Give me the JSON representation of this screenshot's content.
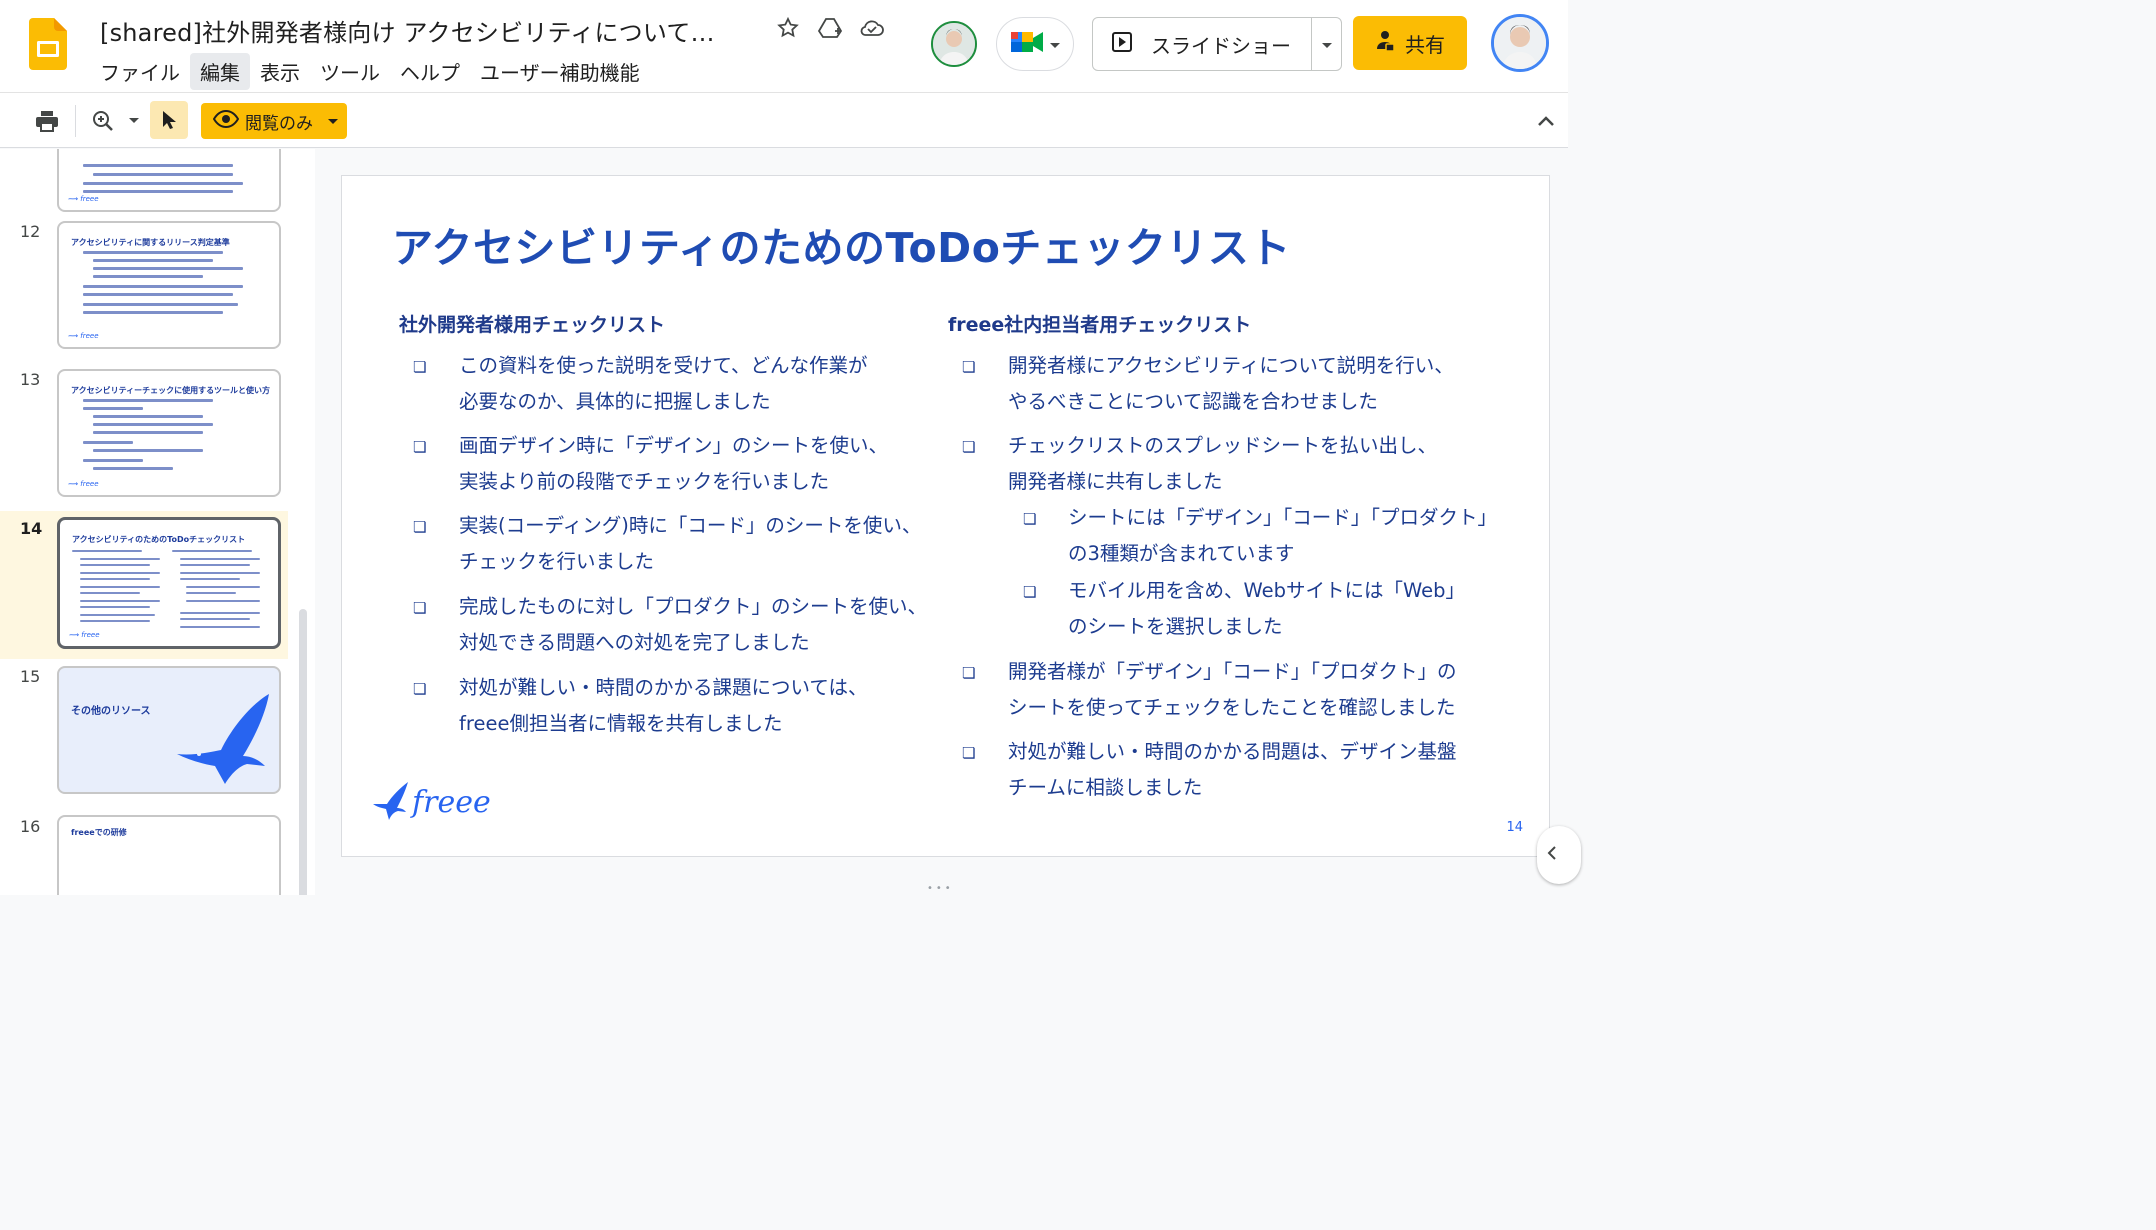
{
  "app": {
    "doc_title": "[shared]社外開発者様向け アクセシビリティについて…",
    "menu": [
      "ファイル",
      "編集",
      "表示",
      "ツール",
      "ヘルプ",
      "ユーザー補助機能"
    ],
    "slideshow_label": "スライドショー",
    "share_label": "共有"
  },
  "toolbar": {
    "view_only_label": "閲覧のみ"
  },
  "colors": {
    "accent": "#fbbc04",
    "slide_blue": "#1f4cb3",
    "brand": "#2864f0"
  },
  "thumbnails": [
    {
      "num": "",
      "title": ""
    },
    {
      "num": "12",
      "title": "アクセシビリティに関するリリース判定基準"
    },
    {
      "num": "13",
      "title": "アクセシビリティーチェックに使用するツールと使い方"
    },
    {
      "num": "14",
      "title": "アクセシビリティのためのToDoチェックリスト"
    },
    {
      "num": "15",
      "title": "その他のリソース"
    },
    {
      "num": "16",
      "title": "freeeでの研修"
    }
  ],
  "slide": {
    "title": "アクセシビリティのためのToDoチェックリスト",
    "left_heading": "社外開発者様用チェックリスト",
    "right_heading": "freee社内担当者用チェックリスト",
    "bullet_symbol": "❏",
    "left_items": [
      [
        "この資料を使った説明を受けて、どんな作業が",
        "必要なのか、具体的に把握しました"
      ],
      [
        "画面デザイン時に「デザイン」のシートを使い、",
        "実装より前の段階でチェックを行いました"
      ],
      [
        "実装(コーディング)時に「コード」のシートを使い、",
        "チェックを行いました"
      ],
      [
        "完成したものに対し「プロダクト」のシートを使い、",
        "対処できる問題への対処を完了しました"
      ],
      [
        "対処が難しい・時間のかかる課題については、",
        "freee側担当者に情報を共有しました"
      ]
    ],
    "right_items": [
      [
        "開発者様にアクセシビリティについて説明を行い、",
        "やるべきことについて認識を合わせました"
      ],
      [
        "チェックリストのスプレッドシートを払い出し、",
        "開発者様に共有しました"
      ],
      [
        "シートには「デザイン」「コード」「プロダクト」",
        "の3種類が含まれています"
      ],
      [
        "モバイル用を含め、Webサイトには「Web」",
        "のシートを選択しました"
      ],
      [
        "開発者様が「デザイン」「コード」「プロダクト」の",
        "シートを使ってチェックをしたことを確認しました"
      ],
      [
        "対処が難しい・時間のかかる問題は、デザイン基盤",
        "チームに相談しました"
      ]
    ],
    "logo_text": "freee",
    "page_number": "14"
  }
}
